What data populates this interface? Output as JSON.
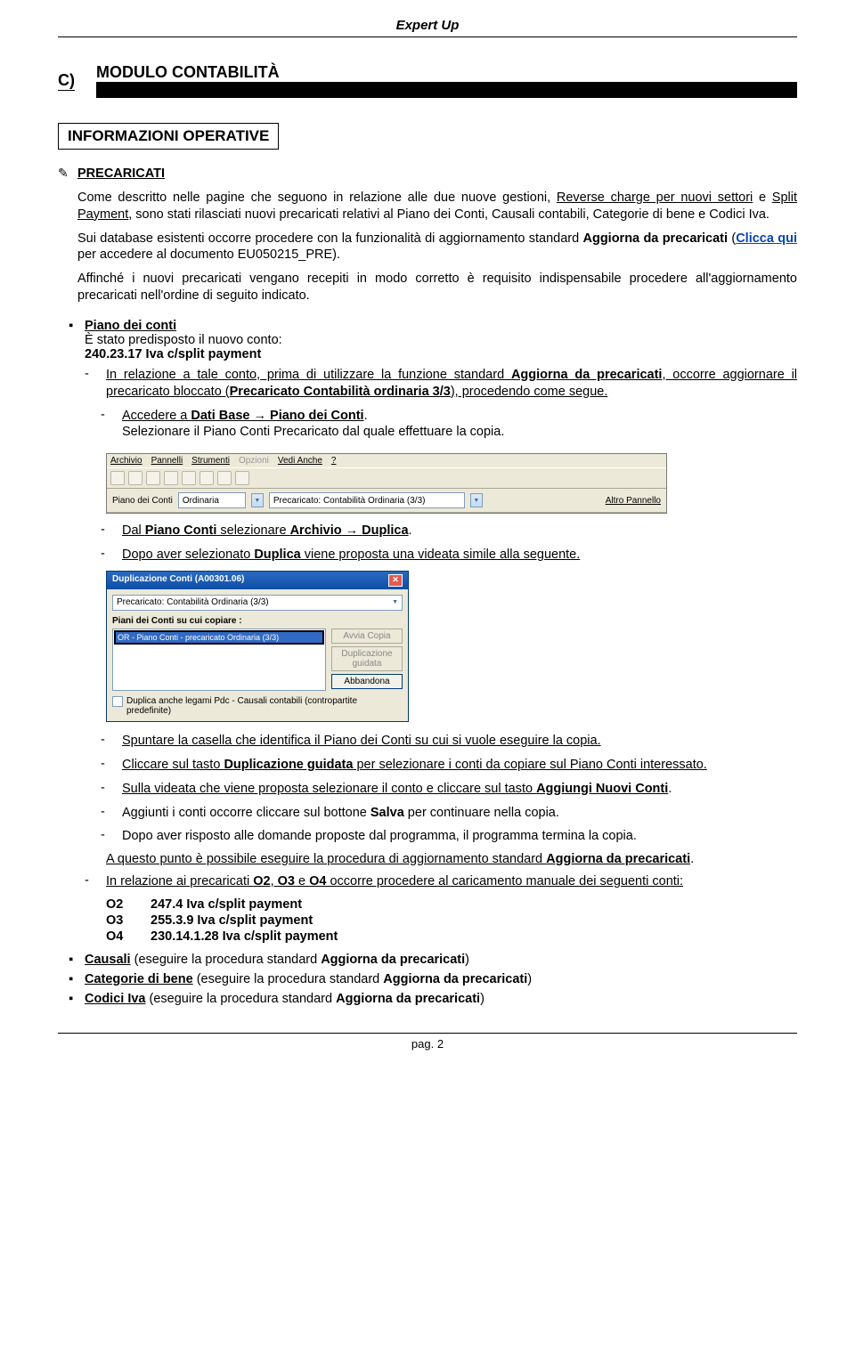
{
  "doc_title": "Expert Up",
  "section": {
    "letter": "C)",
    "name": "MODULO CONTABILITÀ"
  },
  "info_heading": "INFORMAZIONI OPERATIVE",
  "precaricati": {
    "title": "PRECARICATI",
    "p1a": "Come descritto nelle pagine che seguono in relazione alle due nuove gestioni, ",
    "p1b": "Reverse charge per nuovi settori",
    "p1c": " e ",
    "p1d": "Split Payment",
    "p1e": ", sono stati rilasciati nuovi precaricati relativi al Piano dei Conti, Causali contabili, Categorie di bene e Codici Iva.",
    "p2a": "Sui database esistenti occorre procedere con la funzionalità di aggiornamento standard ",
    "p2b": "Aggiorna da precaricati",
    "p2c": " (",
    "p2link": "Clicca qui",
    "p2d": " per accedere al documento EU050215_PRE).",
    "p3": "Affinché i nuovi precaricati vengano recepiti in modo corretto è requisito indispensabile procedere all'aggiornamento precaricati nell'ordine di seguito indicato."
  },
  "piano": {
    "title": "Piano dei conti",
    "sub1": "È stato predisposto il nuovo conto:",
    "code": "240.23.17 Iva c/split payment",
    "d1a": "In relazione a tale conto, prima di utilizzare la funzione standard ",
    "d1b": "Aggiorna da precaricati",
    "d1c": ", occorre aggiornare il precaricato bloccato (",
    "d1d": "Precaricato Contabilità ordinaria 3/3",
    "d1e": "), procedendo come segue.",
    "d2a": "Accedere a ",
    "d2b": "Dati Base",
    "d2c": " → ",
    "d2d": "Piano dei Conti",
    "d2e": ".",
    "d2f": "Selezionare il Piano Conti Precaricato dal quale effettuare la copia.",
    "d3a": "Dal ",
    "d3b": "Piano Conti",
    "d3c": " selezionare ",
    "d3d": "Archivio",
    "d3e": " → ",
    "d3f": "Duplica",
    "d3g": ".",
    "d4a": "Dopo aver selezionato ",
    "d4b": "Duplica",
    "d4c": " viene proposta una videata simile alla seguente.",
    "d5": "Spuntare la casella che identifica il Piano dei Conti su cui si vuole eseguire la copia.",
    "d6a": "Cliccare sul tasto ",
    "d6b": "Duplicazione guidata",
    "d6c": " per selezionare i conti da copiare sul Piano Conti interessato.",
    "d7a": "Sulla videata che viene proposta selezionare il conto e cliccare sul tasto ",
    "d7b": "Aggiungi Nuovi Conti",
    "d7c": ".",
    "d8a": "Aggiunti i conti occorre cliccare sul bottone ",
    "d8b": "Salva",
    "d8c": " per continuare nella copia.",
    "d9": "Dopo aver risposto alle domande proposte dal programma, il programma termina la copia.",
    "fin1a": "A questo punto è possibile eseguire la procedura di aggiornamento standard ",
    "fin1b": "Aggiorna da precaricati",
    "fin1c": ".",
    "rel": {
      "intro_a": "In relazione ai precaricati ",
      "o2": "O2",
      "o3": "O3",
      "e_word": " e ",
      "o4": "O4",
      "intro_b": " occorre procedere al caricamento manuale dei seguenti conti:",
      "rows": [
        {
          "k": "O2",
          "v": "247.4 Iva c/split payment"
        },
        {
          "k": "O3",
          "v": "255.3.9 Iva c/split payment"
        },
        {
          "k": "O4",
          "v": "230.14.1.28 Iva c/split payment"
        }
      ]
    }
  },
  "bottom": {
    "causali_u": "Causali",
    "causali_t": " (eseguire la procedura standard ",
    "causali_b": "Aggiorna da precaricati",
    "causali_e": ")",
    "cat_u": "Categorie di bene",
    "cat_t": " (eseguire la procedura standard ",
    "cat_b": "Aggiorna da precaricati",
    "cat_e": ")",
    "iva_u": "Codici Iva",
    "iva_t": " (eseguire la procedura standard ",
    "iva_b": "Aggiorna da precaricati",
    "iva_e": ")"
  },
  "app_img": {
    "menus": [
      "Archivio",
      "Pannelli",
      "Strumenti",
      "Opzioni",
      "Vedi Anche",
      "?"
    ],
    "lbl_piano": "Piano dei Conti",
    "val_piano": "Ordinaria",
    "lbl_prec": "Precaricato: Contabilità Ordinaria  (3/3)",
    "lbl_altro": "Altro Pannello"
  },
  "dialog": {
    "title": "Duplicazione Conti  (A00301.06)",
    "field_prec": "Precaricato: Contabilità Ordinaria  (3/3)",
    "sub": "Piani dei Conti su cui copiare :",
    "list_item": "OR - Piano Conti - precaricato Ordinaria  (3/3)",
    "btn1": "Avvia Copia",
    "btn2": "Duplicazione guidata",
    "btn3": "Abbandona",
    "chk": "Duplica anche legami Pdc - Causali contabili (contropartite predefinite)"
  },
  "comma": ", ",
  "footer": "pag. 2"
}
